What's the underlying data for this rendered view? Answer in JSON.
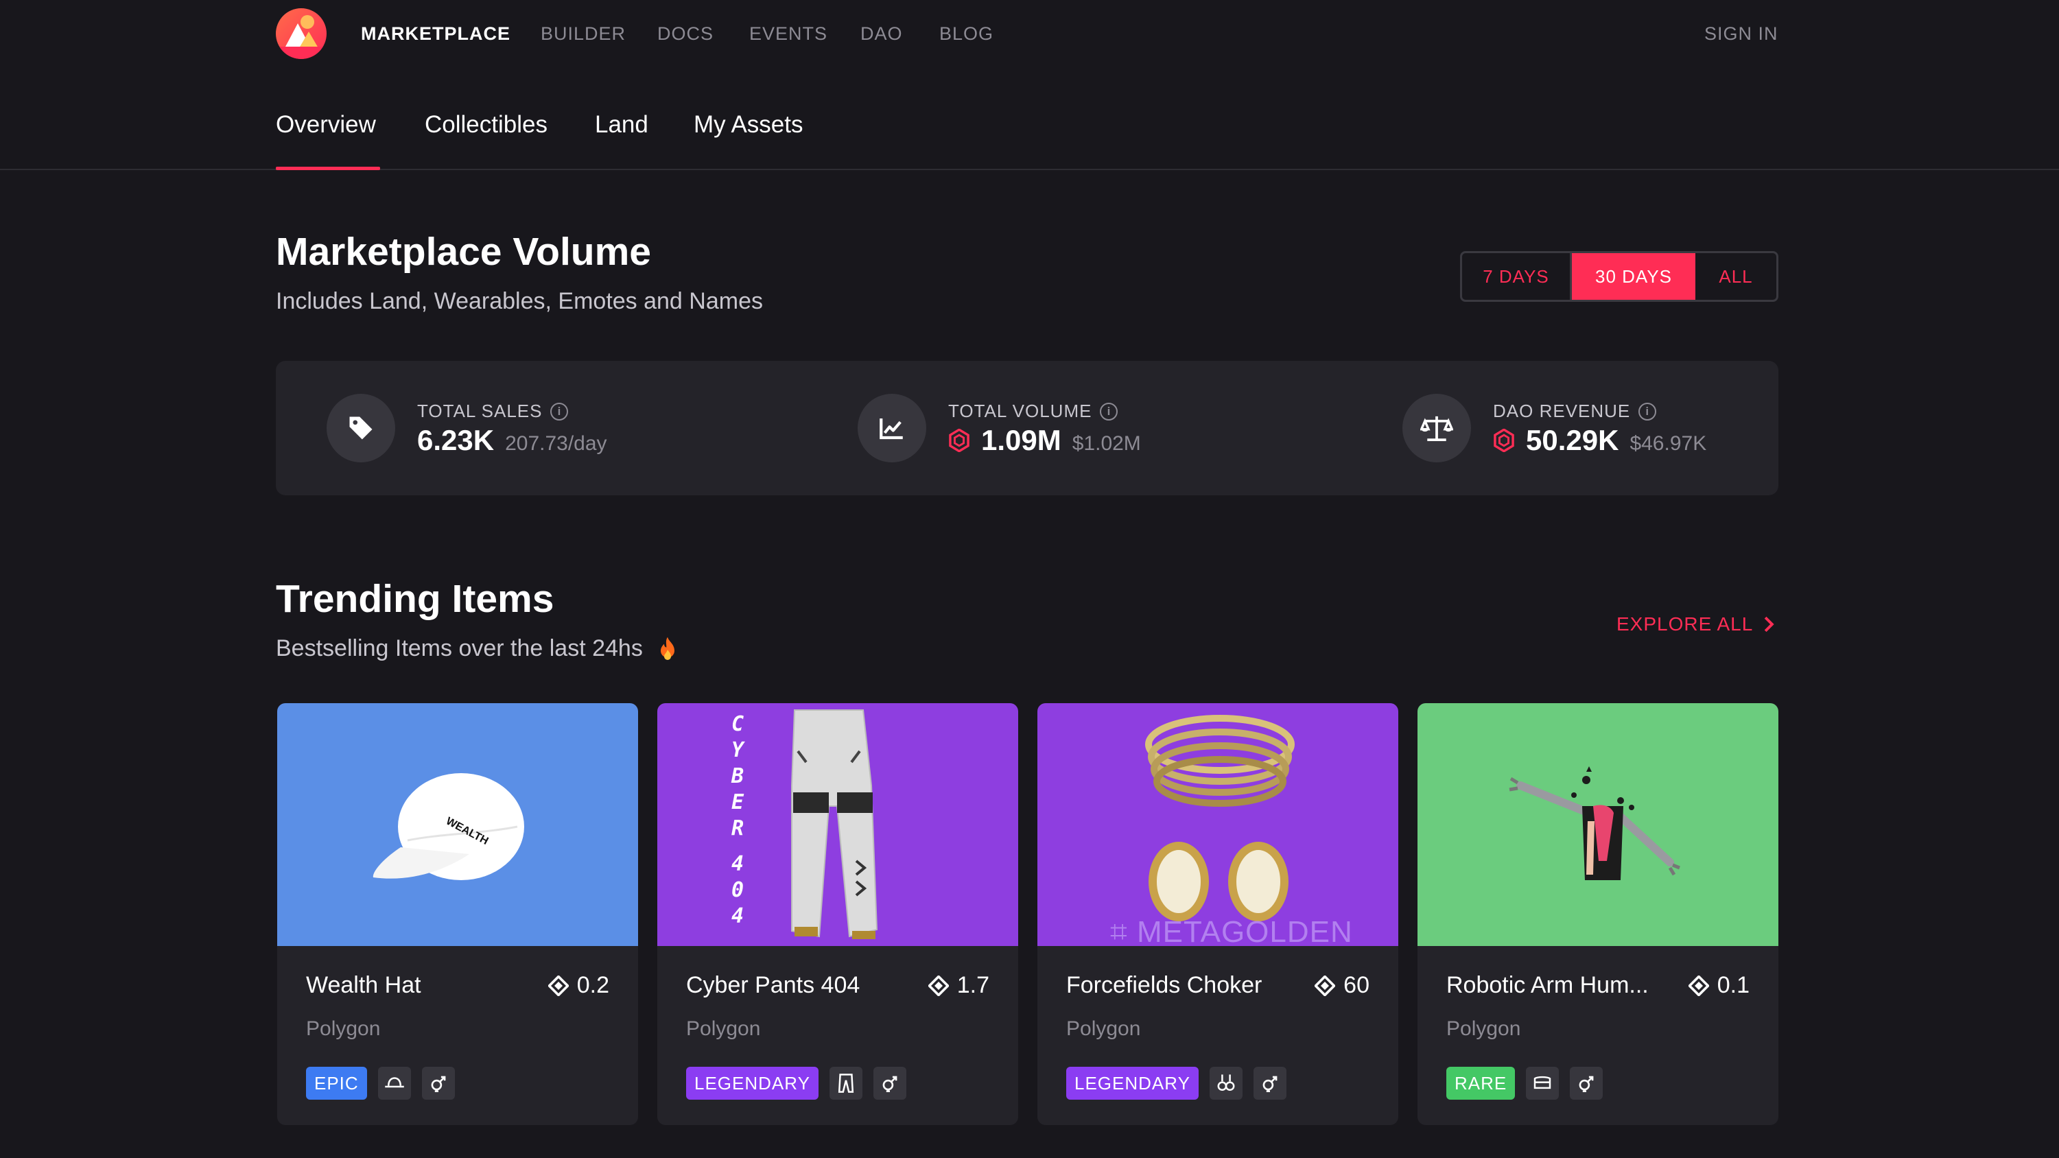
{
  "topnav": {
    "items": [
      {
        "label": "MARKETPLACE",
        "active": true
      },
      {
        "label": "BUILDER",
        "active": false
      },
      {
        "label": "DOCS",
        "active": false
      },
      {
        "label": "EVENTS",
        "active": false
      },
      {
        "label": "DAO",
        "active": false
      },
      {
        "label": "BLOG",
        "active": false
      }
    ],
    "sign_in": "SIGN IN"
  },
  "subtabs": [
    {
      "label": "Overview",
      "active": true
    },
    {
      "label": "Collectibles",
      "active": false
    },
    {
      "label": "Land",
      "active": false
    },
    {
      "label": "My Assets",
      "active": false
    }
  ],
  "volume": {
    "title": "Marketplace Volume",
    "subtitle": "Includes Land, Wearables, Emotes and Names",
    "ranges": [
      {
        "label": "7 DAYS",
        "active": false
      },
      {
        "label": "30 DAYS",
        "active": true
      },
      {
        "label": "ALL",
        "active": false
      }
    ],
    "stats": [
      {
        "icon": "tag-icon",
        "label": "TOTAL SALES",
        "value": "6.23K",
        "secondary": "207.73/day"
      },
      {
        "icon": "chart-line-icon",
        "label": "TOTAL VOLUME",
        "value": "1.09M",
        "secondary": "$1.02M"
      },
      {
        "icon": "scale-icon",
        "label": "DAO REVENUE",
        "value": "50.29K",
        "secondary": "$46.97K"
      }
    ]
  },
  "trending": {
    "title": "Trending Items",
    "subtitle": "Bestselling Items over the last 24hs",
    "explore_all": "EXPLORE ALL",
    "items": [
      {
        "name": "Wealth Hat",
        "price": "0.2",
        "network": "Polygon",
        "rarity": "EPIC",
        "rarity_color": "#3d7bf2",
        "category_icon": "hat-icon",
        "gender_icon": "unisex-icon",
        "bg": "#5b8fe6",
        "hat_text": "WEALTH"
      },
      {
        "name": "Cyber Pants 404",
        "price": "1.7",
        "network": "Polygon",
        "rarity": "LEGENDARY",
        "rarity_color": "#8b3df2",
        "category_icon": "pants-icon",
        "gender_icon": "unisex-icon",
        "bg": "#8e3ee0",
        "side_text": "CYBER404"
      },
      {
        "name": "Forcefields Choker",
        "price": "60",
        "network": "Polygon",
        "rarity": "LEGENDARY",
        "rarity_color": "#8b3df2",
        "category_icon": "earrings-icon",
        "gender_icon": "unisex-icon",
        "bg": "#8e3ee0",
        "brand_text": "METAGOLDEN"
      },
      {
        "name": "Robotic Arm Hum...",
        "price": "0.1",
        "network": "Polygon",
        "rarity": "RARE",
        "rarity_color": "#44c865",
        "category_icon": "top-icon",
        "gender_icon": "unisex-icon",
        "bg": "#6bcc7e"
      }
    ]
  }
}
